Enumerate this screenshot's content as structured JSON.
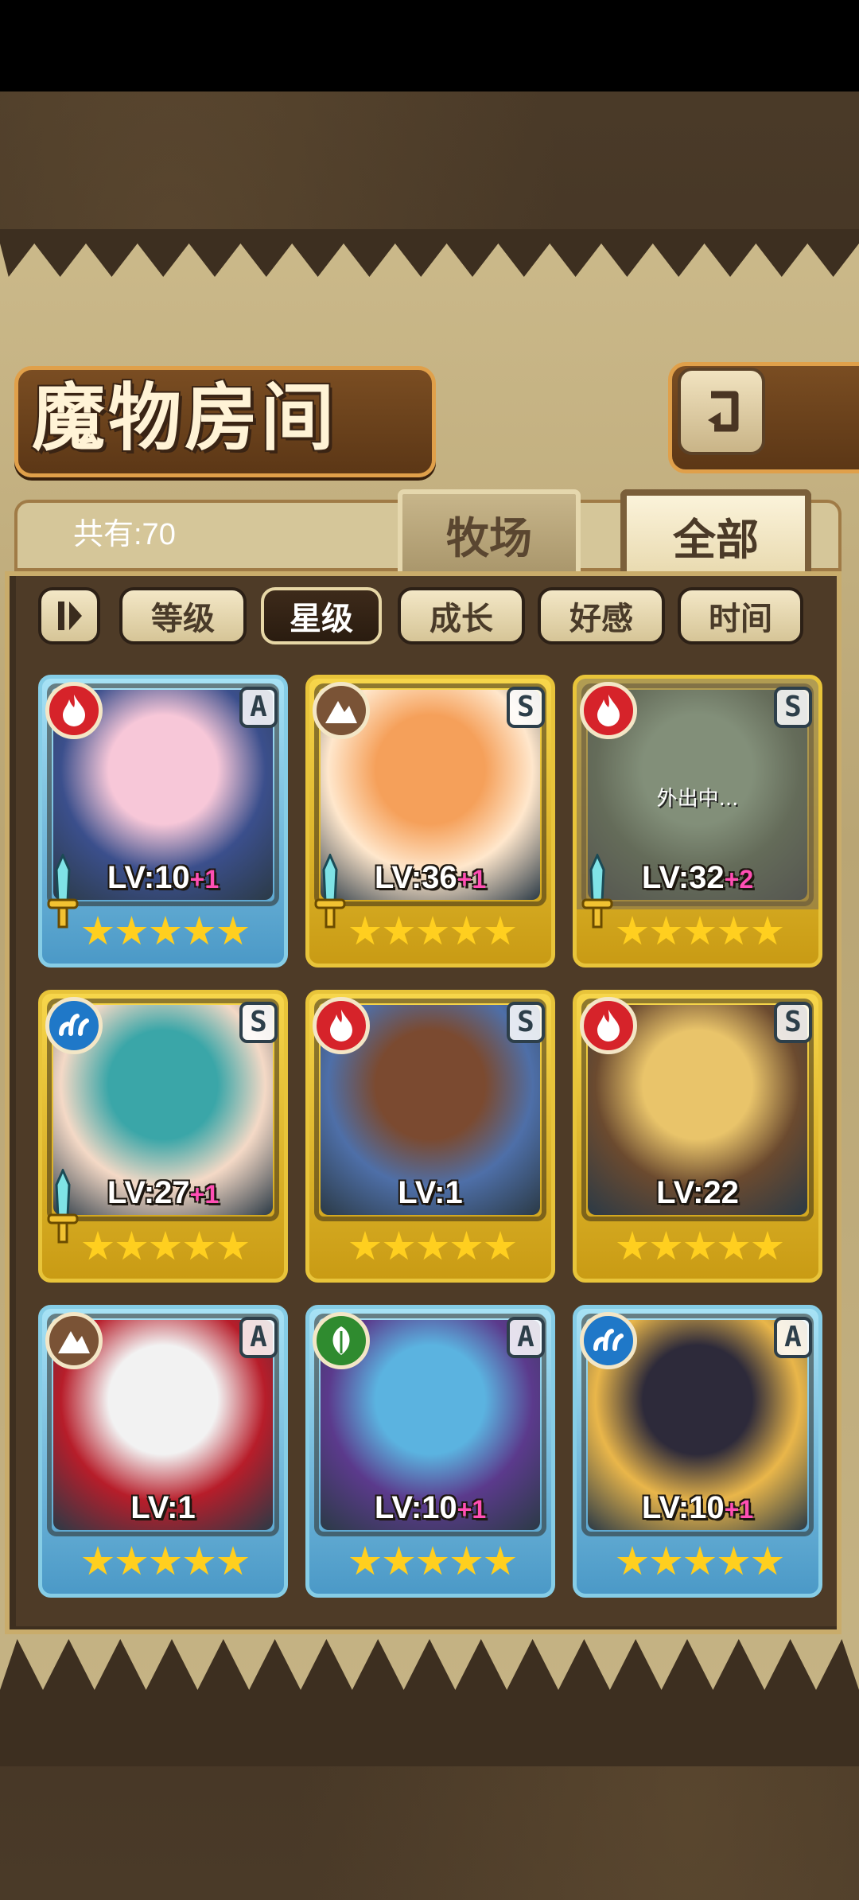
{
  "header": {
    "title": "魔物房间",
    "back_icon": "return-arrow-icon"
  },
  "summary": {
    "count_text": "共有:70"
  },
  "tabs": [
    {
      "label": "牧场",
      "selected": false
    },
    {
      "label": "全部",
      "selected": true
    }
  ],
  "sort": {
    "toggle_icon": "pause-toggle-icon",
    "buttons": [
      {
        "label": "等级",
        "active": false
      },
      {
        "label": "星级",
        "active": true
      },
      {
        "label": "成长",
        "active": false
      },
      {
        "label": "好感",
        "active": false
      },
      {
        "label": "时间",
        "active": false
      }
    ]
  },
  "monsters": [
    {
      "element": "fire",
      "rank": "A",
      "level": "LV:10",
      "bonus": "+1",
      "stars": 5,
      "weapon": true,
      "away": false,
      "colors": [
        "#f7c7d8",
        "#3b4f8c"
      ]
    },
    {
      "element": "earth",
      "rank": "S",
      "level": "LV:36",
      "bonus": "+1",
      "stars": 5,
      "weapon": true,
      "away": false,
      "colors": [
        "#f5a05a",
        "#ffe7cc"
      ]
    },
    {
      "element": "fire",
      "rank": "S",
      "level": "LV:32",
      "bonus": "+2",
      "stars": 5,
      "weapon": true,
      "away": true,
      "away_text": "外出中...",
      "colors": [
        "#8fb9a1",
        "#4d6a5a"
      ]
    },
    {
      "element": "water",
      "rank": "S",
      "level": "LV:27",
      "bonus": "+1",
      "stars": 5,
      "weapon": true,
      "away": false,
      "colors": [
        "#3aa6a8",
        "#f4d9c6"
      ]
    },
    {
      "element": "fire",
      "rank": "S",
      "level": "LV:1",
      "bonus": "",
      "stars": 5,
      "weapon": false,
      "away": false,
      "colors": [
        "#7b4a30",
        "#4e6fa8"
      ]
    },
    {
      "element": "fire",
      "rank": "S",
      "level": "LV:22",
      "bonus": "",
      "stars": 5,
      "weapon": false,
      "away": false,
      "colors": [
        "#e9c46a",
        "#6b4a2f"
      ]
    },
    {
      "element": "earth",
      "rank": "A",
      "level": "LV:1",
      "bonus": "",
      "stars": 5,
      "weapon": false,
      "away": false,
      "colors": [
        "#f2f2f2",
        "#b71d2a"
      ]
    },
    {
      "element": "wood",
      "rank": "A",
      "level": "LV:10",
      "bonus": "+1",
      "stars": 5,
      "weapon": false,
      "away": false,
      "colors": [
        "#5bb3e0",
        "#5b3a8c"
      ]
    },
    {
      "element": "water",
      "rank": "A",
      "level": "LV:10",
      "bonus": "+1",
      "stars": 5,
      "weapon": false,
      "away": false,
      "colors": [
        "#2d2a3a",
        "#e9b64a"
      ]
    }
  ],
  "element_colors": {
    "fire": "#d6232a",
    "earth": "#7a5336",
    "water": "#1f78c8",
    "wood": "#2f8b2f"
  }
}
